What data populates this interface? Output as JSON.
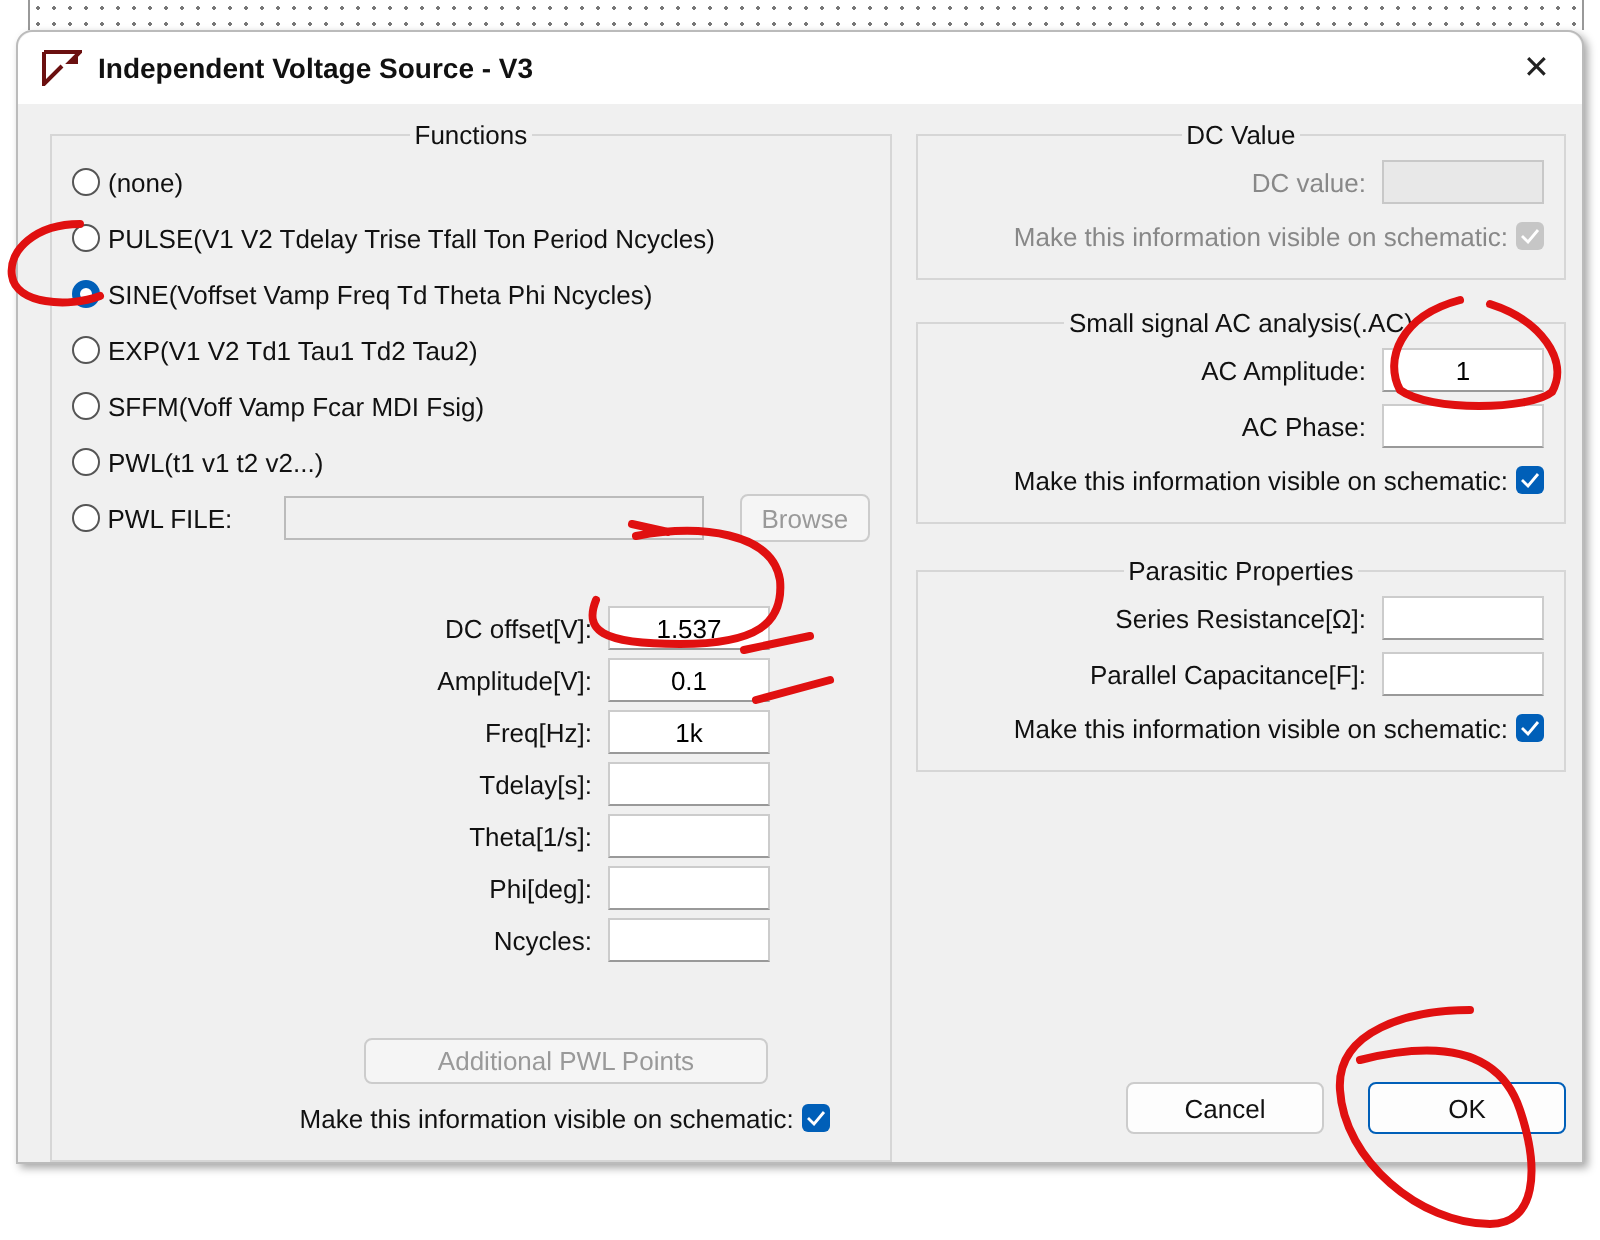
{
  "window": {
    "title": "Independent Voltage Source - V3",
    "close": "✕"
  },
  "functions": {
    "title": "Functions",
    "options": [
      {
        "label": "(none)",
        "selected": false,
        "kind": "plain"
      },
      {
        "label": "PULSE(V1 V2 Tdelay Trise Tfall Ton Period Ncycles)",
        "selected": false,
        "kind": "plain"
      },
      {
        "label": "SINE(Voffset Vamp Freq Td Theta Phi Ncycles)",
        "selected": true,
        "kind": "plain"
      },
      {
        "label": "EXP(V1 V2 Td1 Tau1 Td2 Tau2)",
        "selected": false,
        "kind": "plain"
      },
      {
        "label": "SFFM(Voff Vamp Fcar MDI Fsig)",
        "selected": false,
        "kind": "plain"
      },
      {
        "label": "PWL(t1 v1 t2 v2...)",
        "selected": false,
        "kind": "plain"
      },
      {
        "label": "PWL FILE:",
        "selected": false,
        "kind": "file"
      }
    ],
    "browse_button": {
      "label": "Browse",
      "disabled": true
    },
    "parameters": [
      {
        "label": "DC offset[V]:",
        "value": "1.537"
      },
      {
        "label": "Amplitude[V]:",
        "value": "0.1"
      },
      {
        "label": "Freq[Hz]:",
        "value": "1k"
      },
      {
        "label": "Tdelay[s]:"
      },
      {
        "label": "Theta[1/s]:"
      },
      {
        "label": "Phi[deg]:"
      },
      {
        "label": "Ncycles:"
      }
    ],
    "pwl_button": {
      "label": "Additional PWL Points",
      "disabled": true
    },
    "visible": {
      "label": "Make this information visible on schematic:",
      "checked": true,
      "disabled": false
    }
  },
  "groups": [
    {
      "title": "DC Value",
      "fields": [
        {
          "label": "DC value:"
        }
      ],
      "visible": {
        "label": "Make this information visible on schematic:",
        "checked": true,
        "disabled": true
      },
      "disabled": true
    },
    {
      "title": "Small signal AC analysis(.AC)",
      "fields": [
        {
          "label": "AC Amplitude:",
          "value": "1"
        },
        {
          "label": "AC Phase:"
        }
      ],
      "visible": {
        "label": "Make this information visible on schematic:",
        "checked": true,
        "disabled": false
      },
      "disabled": false
    },
    {
      "title": "Parasitic Properties",
      "fields": [
        {
          "label": "Series Resistance[Ω]:"
        },
        {
          "label": "Parallel Capacitance[F]:"
        }
      ],
      "visible": {
        "label": "Make this information visible on schematic:",
        "checked": true,
        "disabled": false
      },
      "disabled": false
    }
  ],
  "buttons": [
    {
      "label": "Cancel",
      "default": false
    },
    {
      "label": "OK",
      "default": true
    }
  ]
}
